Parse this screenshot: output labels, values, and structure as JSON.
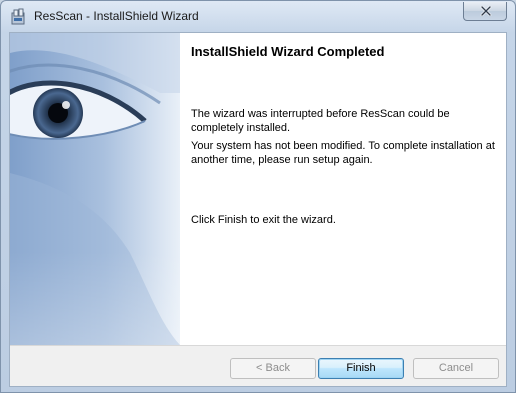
{
  "window": {
    "title": "ResScan - InstallShield Wizard",
    "app_icon": "installer-icon",
    "close_icon": "close-icon"
  },
  "banner": {
    "image": "eye-artwork"
  },
  "content": {
    "heading": "InstallShield Wizard Completed",
    "paragraph1": "The wizard was interrupted before ResScan could be completely installed.",
    "paragraph2": "Your system has not been modified. To complete installation at another time, please run setup again.",
    "paragraph3": "Click Finish to exit the wizard."
  },
  "buttons": {
    "back": "< Back",
    "finish": "Finish",
    "cancel": "Cancel"
  },
  "colors": {
    "titlebar": "#dfe9f5",
    "banner_blue": "#7fa2cd",
    "finish_accent": "#3c7fb1"
  }
}
